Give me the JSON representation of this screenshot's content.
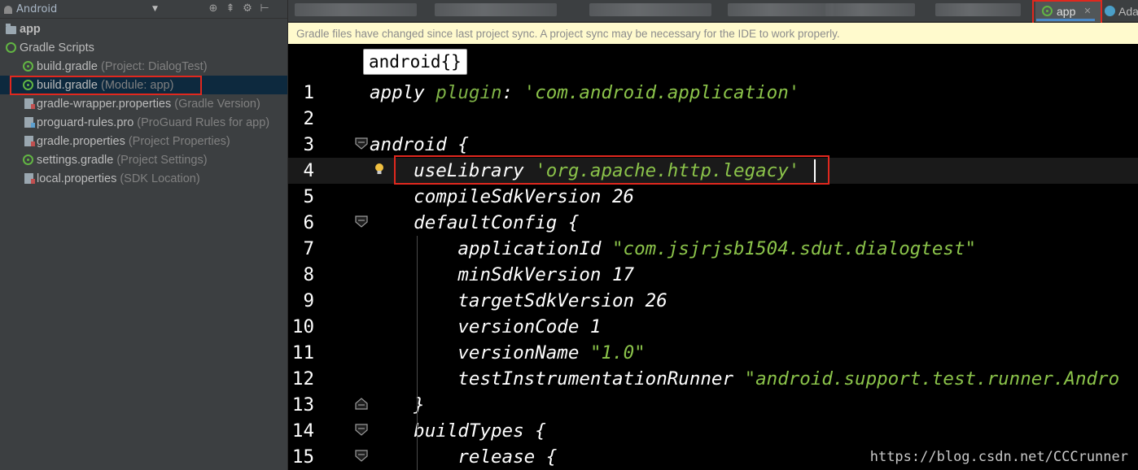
{
  "project_panel": {
    "view_label": "Android",
    "tree": [
      {
        "name": "app",
        "hint": ""
      },
      {
        "name": "Gradle Scripts",
        "hint": ""
      },
      {
        "name": "build.gradle",
        "hint": "(Project: DialogTest)"
      },
      {
        "name": "build.gradle",
        "hint": "(Module: app)"
      },
      {
        "name": "gradle-wrapper.properties",
        "hint": "(Gradle Version)"
      },
      {
        "name": "proguard-rules.pro",
        "hint": "(ProGuard Rules for app)"
      },
      {
        "name": "gradle.properties",
        "hint": "(Project Properties)"
      },
      {
        "name": "settings.gradle",
        "hint": "(Project Settings)"
      },
      {
        "name": "local.properties",
        "hint": "(SDK Location)"
      }
    ]
  },
  "tabs": {
    "active": "app",
    "next": "Ada"
  },
  "banner": {
    "text": "Gradle files have changed since last project sync. A project sync may be necessary for the IDE to work properly."
  },
  "editor": {
    "breadcrumb": "android{}",
    "lines": [
      {
        "n": "1",
        "parts": [
          [
            "plain",
            "apply "
          ],
          [
            "kw",
            "plugin"
          ],
          [
            "plain",
            ": "
          ],
          [
            "str",
            "'com.android.application'"
          ]
        ]
      },
      {
        "n": "2",
        "parts": []
      },
      {
        "n": "3",
        "parts": [
          [
            "plain",
            "android {"
          ]
        ]
      },
      {
        "n": "4",
        "parts": [
          [
            "plain",
            "    useLibrary "
          ],
          [
            "str",
            "'org.apache.http.legacy'"
          ]
        ]
      },
      {
        "n": "5",
        "parts": [
          [
            "plain",
            "    compileSdkVersion 26"
          ]
        ]
      },
      {
        "n": "6",
        "parts": [
          [
            "plain",
            "    defaultConfig {"
          ]
        ]
      },
      {
        "n": "7",
        "parts": [
          [
            "plain",
            "        applicationId "
          ],
          [
            "str",
            "\"com.jsjrjsb1504.sdut.dialogtest\""
          ]
        ]
      },
      {
        "n": "8",
        "parts": [
          [
            "plain",
            "        minSdkVersion 17"
          ]
        ]
      },
      {
        "n": "9",
        "parts": [
          [
            "plain",
            "        targetSdkVersion 26"
          ]
        ]
      },
      {
        "n": "10",
        "parts": [
          [
            "plain",
            "        versionCode 1"
          ]
        ]
      },
      {
        "n": "11",
        "parts": [
          [
            "plain",
            "        versionName "
          ],
          [
            "str",
            "\"1.0\""
          ]
        ]
      },
      {
        "n": "12",
        "parts": [
          [
            "plain",
            "        testInstrumentationRunner "
          ],
          [
            "str",
            "\"android.support.test.runner.Andro"
          ]
        ]
      },
      {
        "n": "13",
        "parts": [
          [
            "plain",
            "    }"
          ]
        ]
      },
      {
        "n": "14",
        "parts": [
          [
            "plain",
            "    buildTypes {"
          ]
        ]
      },
      {
        "n": "15",
        "parts": [
          [
            "plain",
            "        release {"
          ]
        ]
      }
    ],
    "current_line": "4"
  },
  "watermark": "https://blog.csdn.net/CCCrunner",
  "colors": {
    "keyword_green": "#7fb347",
    "string_green": "#8bc34a",
    "highlight_red": "#e0281e",
    "banner_bg": "#fffacd"
  }
}
